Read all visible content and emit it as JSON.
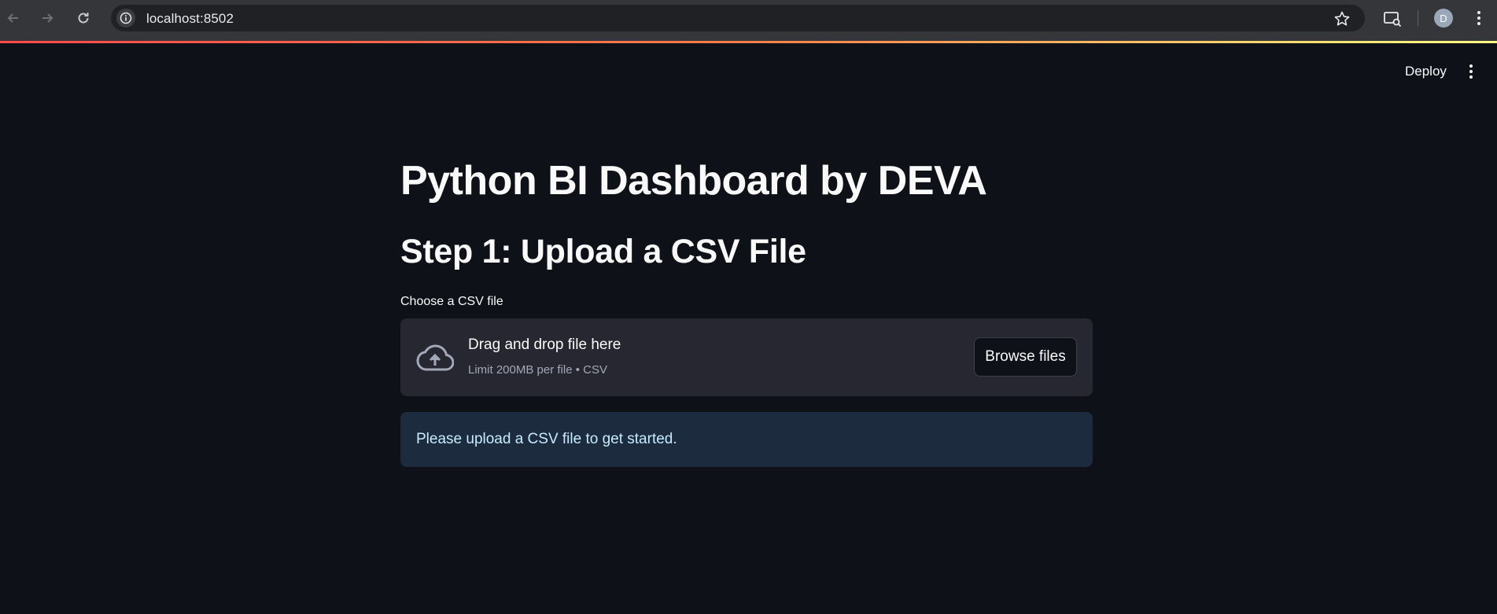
{
  "browser": {
    "url": "localhost:8502",
    "profile_initial": "D"
  },
  "header": {
    "deploy_label": "Deploy"
  },
  "main": {
    "title": "Python BI Dashboard by DEVA",
    "step_heading": "Step 1: Upload a CSV File",
    "uploader": {
      "label": "Choose a CSV file",
      "drop_text": "Drag and drop file here",
      "limit_text": "Limit 200MB per file • CSV",
      "browse_label": "Browse files"
    },
    "info_message": "Please upload a CSV file to get started."
  },
  "colors": {
    "background": "#0e1117",
    "dropzone": "#262730",
    "info_bg": "#1c2b3d",
    "info_text": "#c7ebff",
    "accent_gradient_start": "#ff4b4b",
    "accent_gradient_end": "#fffd80"
  },
  "icons": [
    "back-arrow-icon",
    "forward-arrow-icon",
    "reload-icon",
    "site-info-icon",
    "bookmark-star-icon",
    "cast-search-icon",
    "browser-menu-icon",
    "more-options-icon",
    "cloud-upload-icon"
  ]
}
